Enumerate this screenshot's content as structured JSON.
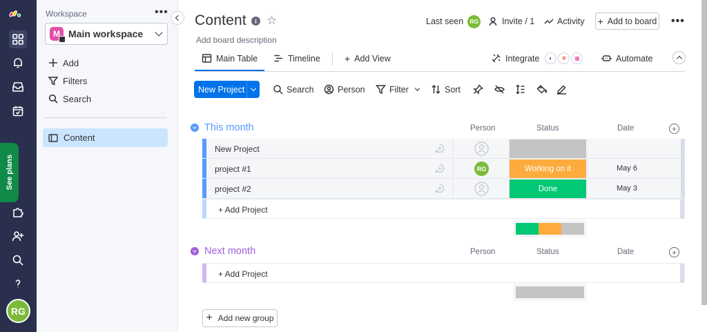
{
  "rail": {
    "icons": [
      "monday-logo-icon",
      "apps-grid-icon",
      "bell-icon",
      "inbox-icon",
      "calendar-check-icon",
      "puzzle-icon",
      "invite-user-icon",
      "search-icon",
      "help-icon"
    ],
    "see_plans": "See plans",
    "user_initials": "RG",
    "colors": {
      "rail_bg": "#292f4c",
      "see_plans_bg": "#0f8a49",
      "avatar_bg": "#7cbb3a"
    }
  },
  "sidebar": {
    "workspace_label": "Workspace",
    "more": "•••",
    "workspace": {
      "badge": "M",
      "name": "Main workspace"
    },
    "items": [
      {
        "label": "Add",
        "icon": "plus-icon"
      },
      {
        "label": "Filters",
        "icon": "filter-icon"
      },
      {
        "label": "Search",
        "icon": "search-icon"
      }
    ],
    "boards": [
      {
        "label": "Content",
        "icon": "board-icon",
        "selected": true
      }
    ]
  },
  "header": {
    "title": "Content",
    "info": "i",
    "description": "Add board description",
    "last_seen": "Last seen",
    "last_seen_initials": "RG",
    "invite": "Invite / 1",
    "activity": "Activity",
    "add_to_board": "Add to board",
    "more": "•••"
  },
  "tabs": {
    "items": [
      {
        "label": "Main Table",
        "icon": "table-icon",
        "active": true
      },
      {
        "label": "Timeline",
        "icon": "timeline-icon",
        "active": false
      }
    ],
    "add_view": "Add View",
    "integrate": "Integrate",
    "automate": "Automate"
  },
  "toolbar": {
    "new_item": "New Project",
    "search": "Search",
    "person": "Person",
    "filter": "Filter",
    "sort": "Sort"
  },
  "columns": {
    "person": "Person",
    "status": "Status",
    "date": "Date"
  },
  "groups": [
    {
      "title": "This month",
      "color": "#579bfc",
      "rows": [
        {
          "name": "New Project",
          "status": "",
          "status_color": "#c4c4c4",
          "date": "",
          "assignee": ""
        },
        {
          "name": "project #1",
          "status": "Working on it",
          "status_color": "#fdab3d",
          "date": "May 6",
          "assignee": "RG"
        },
        {
          "name": "project #2",
          "status": "Done",
          "status_color": "#00c875",
          "date": "May 3",
          "assignee": ""
        }
      ],
      "add_item": "+ Add Project",
      "status_summary": [
        {
          "color": "#00c875",
          "fraction": 0.333
        },
        {
          "color": "#fdab3d",
          "fraction": 0.333
        },
        {
          "color": "#c4c4c4",
          "fraction": 0.334
        }
      ]
    },
    {
      "title": "Next month",
      "color": "#a25ddc",
      "rows": [],
      "add_item": "+ Add Project",
      "status_summary": [
        {
          "color": "#c4c4c4",
          "fraction": 1.0
        }
      ]
    }
  ],
  "add_group": "Add new group"
}
